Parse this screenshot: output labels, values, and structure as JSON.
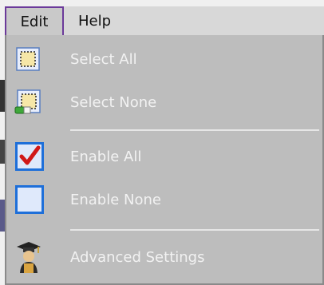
{
  "menubar": {
    "edit_label": "Edit",
    "help_label": "Help"
  },
  "menu": {
    "items": [
      {
        "label": "Select All",
        "icon": "select-all-icon"
      },
      {
        "label": "Select None",
        "icon": "select-none-icon"
      },
      {
        "label": "Enable All",
        "icon": "checked-checkbox-icon"
      },
      {
        "label": "Enable None",
        "icon": "unchecked-checkbox-icon"
      },
      {
        "label": "Advanced Settings",
        "icon": "graduate-icon"
      }
    ]
  },
  "colors": {
    "menu_background": "#bdbdbd",
    "menu_text": "#f2f2f2",
    "active_menu_border": "#6b3a9a",
    "checkbox_blue": "#1e6fd9",
    "check_red": "#d01818"
  }
}
